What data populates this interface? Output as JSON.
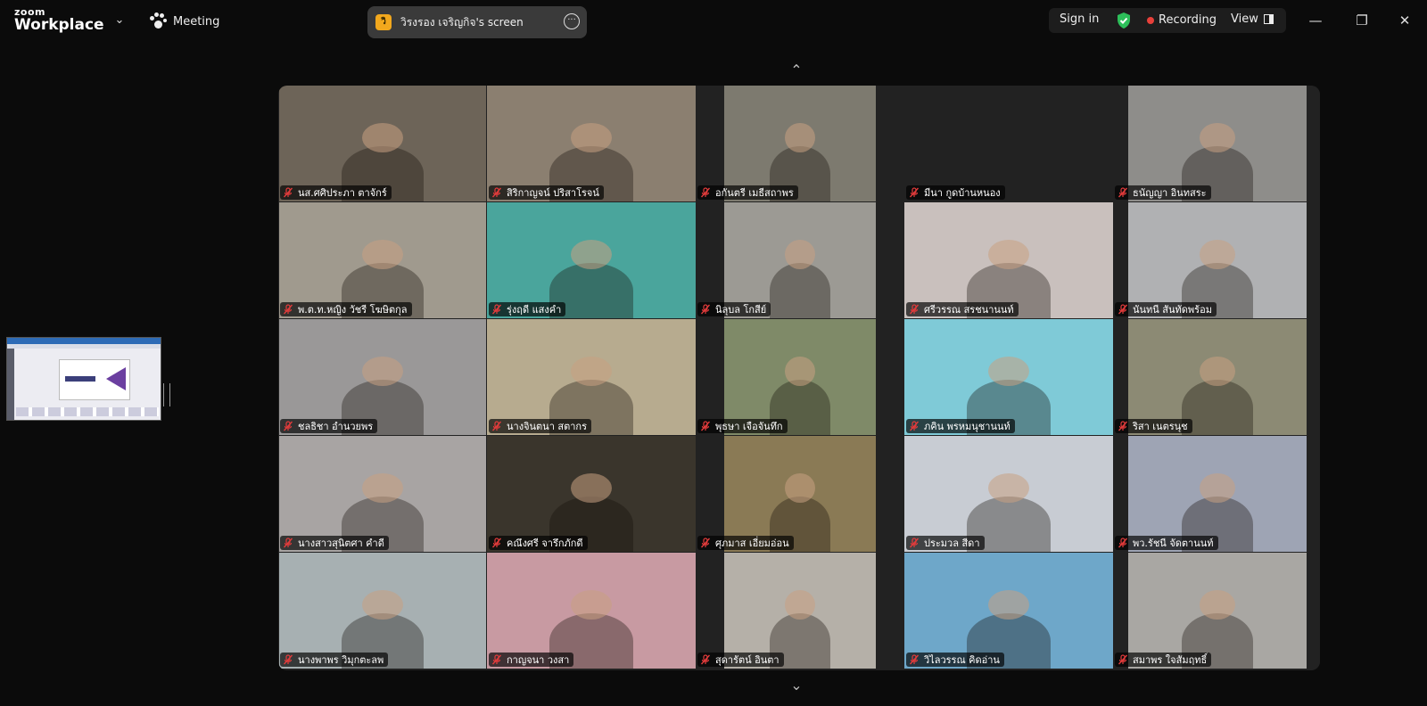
{
  "app": {
    "brand_top": "zoom",
    "brand_bottom": "Workplace"
  },
  "header": {
    "meeting_label": "Meeting",
    "share_badge": "วิ",
    "share_label": "วิรงรอง เจริญกิจ's screen",
    "sign_in": "Sign in",
    "recording": "Recording",
    "view": "View"
  },
  "colors": {
    "accent": "#f2a81d",
    "recording": "#e8403a",
    "shield": "#2dbf5a",
    "mic_off": "#e23b3b"
  },
  "participants": [
    {
      "name": "นส.ศศิประภา ตาจักร์",
      "bg": "#6d6458"
    },
    {
      "name": "สิริกาญจน์ ปริสาโรจน์",
      "bg": "#8b7f70"
    },
    {
      "name": "อกันตรี เมธีสถาพร",
      "bg": "#7d7a6f"
    },
    {
      "name": "มีนา กูดบ้านหนอง",
      "bg": "#222222",
      "blank": true
    },
    {
      "name": "ธนัญญา อินทสระ",
      "bg": "#8e8d8a"
    },
    {
      "name": "พ.ต.ท.หญิง วัชรี โฆษิตกุล",
      "bg": "#a09a8e"
    },
    {
      "name": "รุ่งฤดี  แสงคำ",
      "bg": "#4aa59c"
    },
    {
      "name": "นิลุบล โกสีย์",
      "bg": "#9c9a94"
    },
    {
      "name": "ศรีวรรณ สรชนานนท์",
      "bg": "#c9c0bd"
    },
    {
      "name": "นันทนี สันทัดพร้อม",
      "bg": "#b0b1b3"
    },
    {
      "name": "ชลธิชา อำนวยพร",
      "bg": "#9a9898"
    },
    {
      "name": "นางจินตนา สตากร",
      "bg": "#b7ab8f"
    },
    {
      "name": "พุธษา  เจือจันทึก",
      "bg": "#7f8a68"
    },
    {
      "name": "ภคิน พรหมนุชานนท์",
      "bg": "#7fcad7"
    },
    {
      "name": "ริสา เนตรนุช",
      "bg": "#8c8a74"
    },
    {
      "name": "นางสาวสุนิตศา  คำดี",
      "bg": "#a8a4a3"
    },
    {
      "name": "คณึงศรี  จารึกภักดี",
      "bg": "#3a352c"
    },
    {
      "name": "ศุภมาส เอี่ยมอ่อน",
      "bg": "#8a7a55"
    },
    {
      "name": "ประมวล สีดา",
      "bg": "#c8ccd3"
    },
    {
      "name": "พว.รัชนี จัดตานนท์",
      "bg": "#9ea4b4"
    },
    {
      "name": "นางพาพร วิมุกตะลพ",
      "bg": "#a7b0b2"
    },
    {
      "name": "กาญจนา วงสา",
      "bg": "#c89aa2"
    },
    {
      "name": "สุดารัตน์  อินตา",
      "bg": "#b5b0a8"
    },
    {
      "name": "วิไลวรรณ คิดอ่าน",
      "bg": "#6ea7c9"
    },
    {
      "name": "สมาพร  ใจสัมฤทธิ์",
      "bg": "#a9a7a3"
    }
  ]
}
